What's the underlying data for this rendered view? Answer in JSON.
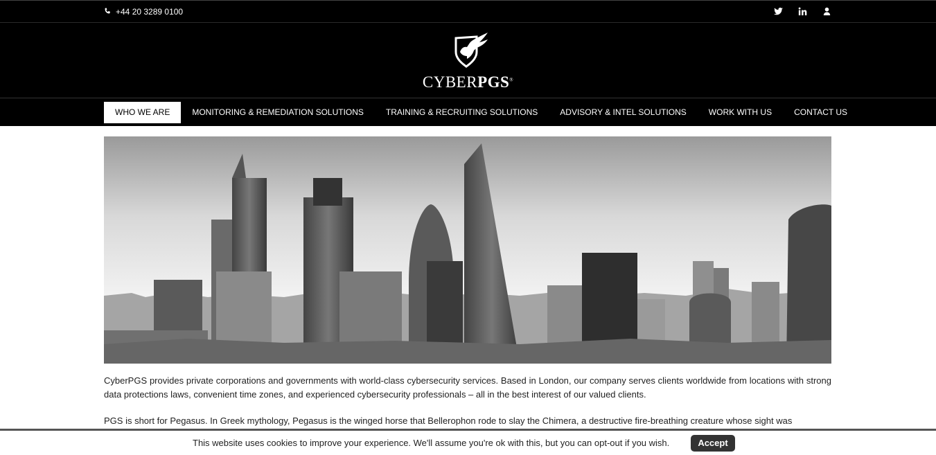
{
  "topbar": {
    "phone": "+44 20 3289 0100",
    "phone_icon": "phone-icon",
    "social_icons": [
      "twitter-icon",
      "linkedin-icon",
      "user-icon"
    ]
  },
  "logo": {
    "brand_light": "CYBER",
    "brand_bold": "PGS",
    "registered": "®"
  },
  "nav": {
    "items": [
      {
        "label": "WHO WE ARE",
        "active": true
      },
      {
        "label": "MONITORING & REMEDIATION SOLUTIONS"
      },
      {
        "label": "TRAINING & RECRUITING SOLUTIONS"
      },
      {
        "label": "ADVISORY & INTEL SOLUTIONS"
      },
      {
        "label": "WORK WITH US"
      },
      {
        "label": "CONTACT US"
      }
    ]
  },
  "content": {
    "p1": "CyberPGS provides private corporations and governments with world-class cybersecurity services. Based in London, our company serves clients worldwide from locations with strong data protections laws, convenient time zones, and experienced cybersecurity professionals – all in the best interest of our valued clients.",
    "p2": "PGS is short for Pegasus. In Greek mythology, Pegasus is the winged horse that Bellerophon rode to slay the Chimera, a destructive fire-breathing creature whose sight was"
  },
  "cookie": {
    "message": "This website uses cookies to improve your experience. We'll assume you're ok with this, but you can opt-out if you wish.",
    "accept_label": "Accept"
  },
  "colors": {
    "header_bg": "#000000",
    "nav_active_bg": "#ffffff",
    "accept_bg": "#333333"
  }
}
